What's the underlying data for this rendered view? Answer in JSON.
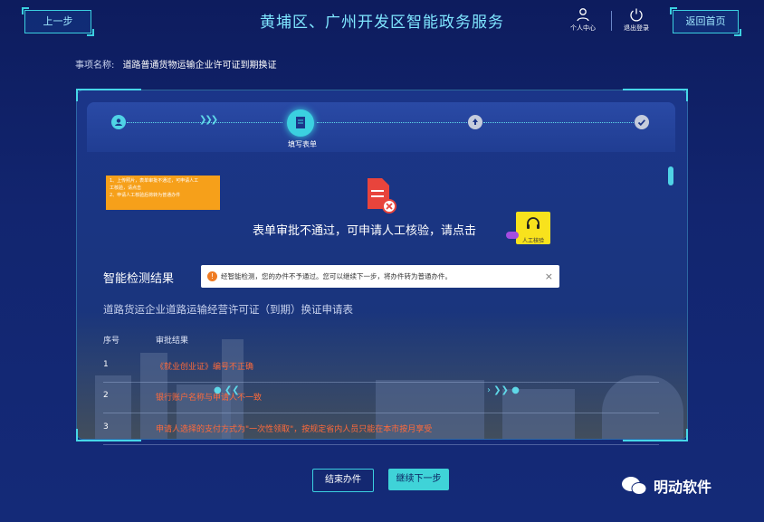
{
  "header": {
    "back_label": "上一步",
    "title": "黄埔区、广州开发区智能政务服务",
    "profile_label": "个人中心",
    "logout_label": "退出登录",
    "home_label": "返回首页"
  },
  "item": {
    "label": "事项名称:",
    "value": "道路普通货物运输企业许可证到期换证"
  },
  "steps": [
    {
      "label": ""
    },
    {
      "label": "填写表单"
    },
    {
      "label": ""
    },
    {
      "label": ""
    }
  ],
  "note": {
    "line1": "1、上传照片，表单审批不通过，可申请人工",
    "line2": "工核验，请点击",
    "line3": "2、申请人工核验后将转为普通办件"
  },
  "review": {
    "message": "表单审批不通过，可申请人工核验，请点击",
    "manual_label": "人工核验"
  },
  "detection": {
    "title": "智能检测结果",
    "notice": "经智能检测，您的办件不予通过。您可以继续下一步，将办件转为普通办件。",
    "close": "×"
  },
  "table": {
    "form_name": "道路货运企业道路运输经营许可证（到期）换证申请表",
    "col_index": "序号",
    "col_result": "审批结果",
    "rows": [
      {
        "index": "1",
        "result": "《就业创业证》编号不正确"
      },
      {
        "index": "2",
        "result": "银行账户名称与申请人不一致"
      },
      {
        "index": "3",
        "result": "申请人选择的支付方式为\"一次性领取\"，按规定省内人员只能在本市按月享受"
      }
    ]
  },
  "actions": {
    "end_label": "结束办件",
    "next_label": "继续下一步"
  },
  "watermark": "明动软件",
  "colors": {
    "accent": "#3bd0e0",
    "warning": "#ff6a3a",
    "yellow": "#f8e21d",
    "orange": "#f6a01a"
  }
}
